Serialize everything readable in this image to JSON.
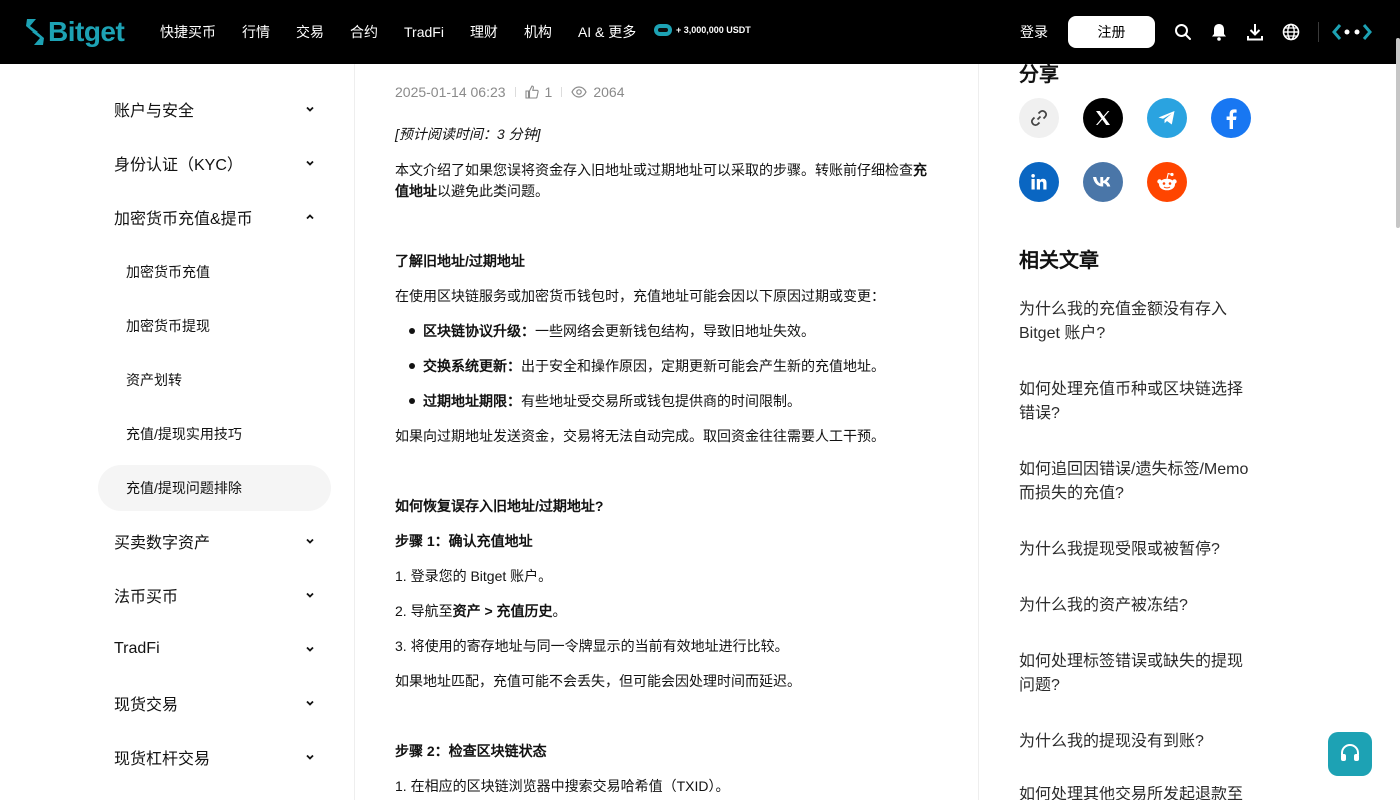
{
  "brand": {
    "name": "Bitget",
    "accent": "#1da2b4"
  },
  "nav": {
    "items": [
      "快捷买币",
      "行情",
      "交易",
      "合约",
      "TradFi",
      "理财",
      "机构",
      "AI & 更多"
    ],
    "promo": "+ 3,000,000 USDT",
    "login": "登录",
    "register": "注册",
    "icons": [
      "search-icon",
      "bell-icon",
      "download-icon",
      "globe-icon",
      "brand-icon"
    ]
  },
  "sidebar": {
    "sections": [
      {
        "label": "账户与安全",
        "expanded": false
      },
      {
        "label": "身份认证（KYC）",
        "expanded": false
      },
      {
        "label": "加密货币充值&提币",
        "expanded": true,
        "children": [
          "加密货币充值",
          "加密货币提现",
          "资产划转",
          "充值/提现实用技巧",
          "充值/提现问题排除"
        ],
        "active_child": "充值/提现问题排除"
      },
      {
        "label": "买卖数字资产",
        "expanded": false
      },
      {
        "label": "法币买币",
        "expanded": false
      },
      {
        "label": "TradFi",
        "expanded": false
      },
      {
        "label": "现货交易",
        "expanded": false
      },
      {
        "label": "现货杠杆交易",
        "expanded": false
      }
    ]
  },
  "article": {
    "date": "2025-01-14 06:23",
    "likes": "1",
    "views": "2064",
    "read_time": "[预计阅读时间：3 分钟]",
    "intro_a": "本文介绍了如果您误将资金存入旧地址或过期地址可以采取的步骤。转账前仔细检查",
    "intro_b": "充值地址",
    "intro_c": "以避免此类问题。",
    "h1": "了解旧地址/过期地址",
    "p1": "在使用区块链服务或加密货币钱包时，充值地址可能会因以下原因过期或变更：",
    "bullets": [
      {
        "b": "区块链协议升级：",
        "t": "一些网络会更新钱包结构，导致旧地址失效。"
      },
      {
        "b": "交换系统更新：",
        "t": "出于安全和操作原因，定期更新可能会产生新的充值地址。"
      },
      {
        "b": "过期地址期限：",
        "t": "有些地址受交易所或钱包提供商的时间限制。"
      }
    ],
    "p2": "如果向过期地址发送资金，交易将无法自动完成。取回资金往往需要人工干预。",
    "h2": "如何恢复误存入旧地址/过期地址?",
    "step1": "步骤 1：确认充值地址",
    "s1_1": "1. 登录您的 Bitget 账户。",
    "s1_2a": "2. 导航至",
    "s1_2b": "资产 > 充值历史",
    "s1_2c": "。",
    "s1_3": "3. 将使用的寄存地址与同一令牌显示的当前有效地址进行比较。",
    "p3": "如果地址匹配，充值可能不会丢失，但可能会因处理时间而延迟。",
    "step2": "步骤 2：检查区块链状态",
    "s2_1": "1. 在相应的区块链浏览器中搜索交易哈希值（TXID）。"
  },
  "share": {
    "title": "分享",
    "buttons": [
      "link-icon",
      "x-icon",
      "telegram-icon",
      "facebook-icon",
      "linkedin-icon",
      "vk-icon",
      "reddit-icon"
    ]
  },
  "related": {
    "title": "相关文章",
    "items": [
      "为什么我的充值金额没有存入 Bitget 账户?",
      "如何处理充值币种或区块链选择错误?",
      "如何追回因错误/遗失标签/Memo而损失的充值?",
      "为什么我提现受限或被暂停?",
      "为什么我的资产被冻结?",
      "如何处理标签错误或缺失的提现问题?",
      "为什么我的提现没有到账?",
      "如何处理其他交易所发起退款至"
    ]
  }
}
